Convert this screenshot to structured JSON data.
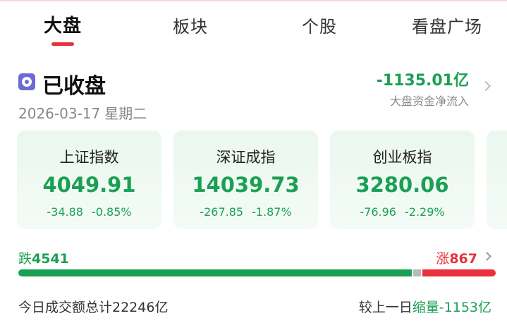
{
  "tabs": [
    {
      "label": "大盘",
      "active": true
    },
    {
      "label": "板块",
      "active": false
    },
    {
      "label": "个股",
      "active": false
    },
    {
      "label": "看盘广场",
      "active": false
    }
  ],
  "status": {
    "icon": "closed-status-icon",
    "text": "已收盘",
    "date": "2026-03-17",
    "weekday": "星期二"
  },
  "capital_flow": {
    "value": "-1135.01亿",
    "label": "大盘资金净流入"
  },
  "indices": [
    {
      "name": "上证指数",
      "value": "4049.91",
      "change": "-34.88",
      "change_pct": "-0.85%"
    },
    {
      "name": "深证成指",
      "value": "14039.73",
      "change": "-267.85",
      "change_pct": "-1.87%"
    },
    {
      "name": "创业板指",
      "value": "3280.06",
      "change": "-76.96",
      "change_pct": "-2.29%"
    }
  ],
  "breadth": {
    "fall_label": "跌",
    "fall_count": "4541",
    "rise_label": "涨",
    "rise_count": "867",
    "fall_fraction": 0.829,
    "flat_fraction": 0.016,
    "rise_fraction": 0.155
  },
  "turnover": {
    "text": "今日成交额总计22246亿",
    "compare_prefix": "较上一日",
    "compare_delta": "缩量-1153亿"
  },
  "colors": {
    "down": "#1aa053",
    "up": "#e8313b",
    "flat": "#b9b9b9",
    "accent": "#e8313b"
  }
}
